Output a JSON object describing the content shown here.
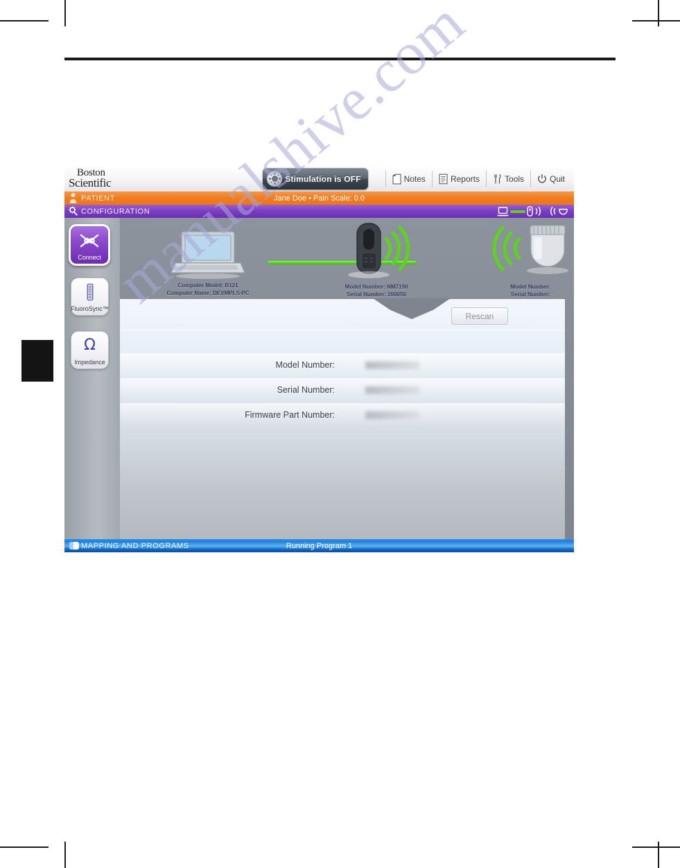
{
  "page": {
    "watermark": "manualshive.com"
  },
  "app": {
    "brand": {
      "line1": "Boston",
      "line2": "Scientific"
    },
    "stimulation": {
      "label": "Stimulation is OFF",
      "icon": "stimulation-sun-icon"
    },
    "tools": [
      {
        "id": "notes",
        "label": "Notes",
        "icon": "note-page-icon"
      },
      {
        "id": "reports",
        "label": "Reports",
        "icon": "report-document-icon"
      },
      {
        "id": "tools",
        "label": "Tools",
        "icon": "fork-knife-tools-icon"
      },
      {
        "id": "quit",
        "label": "Quit",
        "icon": "power-icon"
      }
    ],
    "patient_bar": {
      "title": "PATIENT",
      "info": "Jane Doe  •  Pain Scale: 0.0",
      "icon": "person-icon",
      "color": "#ed7716"
    },
    "config_bar": {
      "title": "CONFIGURATION",
      "icon": "gear-wand-icon",
      "color": "#7c3fc4",
      "link_status": [
        "laptop-icon",
        "green-link-icon",
        "wand-icon",
        "signal-waves-icon",
        "signal-waves-icon",
        "ipg-icon"
      ]
    },
    "sidebar": [
      {
        "id": "connect",
        "label": "Connect",
        "icon": "connect-link-icon",
        "active": true
      },
      {
        "id": "fluorosync",
        "label": "FluoroSync™",
        "icon": "fluoro-probe-icon",
        "active": false
      },
      {
        "id": "impedance",
        "label": "Impedance",
        "icon": "omega-icon",
        "active": false,
        "glyph": "Ω"
      }
    ],
    "devices": [
      {
        "id": "computer",
        "icon": "laptop-icon",
        "lines": [
          "Computer Model: B121",
          "Computer Name: DEVMPLS-PC"
        ]
      },
      {
        "id": "programmer-wand",
        "icon": "wand-icon",
        "lines": [
          "Model Number: NM7190",
          "Serial Number: 200056"
        ]
      },
      {
        "id": "ipg",
        "icon": "ipg-icon",
        "lines": [
          "Model Number:",
          "Serial Number:"
        ]
      }
    ],
    "panel": {
      "rescan_label": "Rescan",
      "fields": [
        {
          "id": "model",
          "label": "Model Number:",
          "value": ""
        },
        {
          "id": "serial",
          "label": "Serial Number:",
          "value": ""
        },
        {
          "id": "firmware",
          "label": "Firmware Part Number:",
          "value": ""
        }
      ]
    },
    "bottom_bar": {
      "title": "MAPPING AND PROGRAMS",
      "info": "Running Program 1",
      "icon": "program-toggle-icon",
      "color": "#1f7fdd"
    }
  }
}
